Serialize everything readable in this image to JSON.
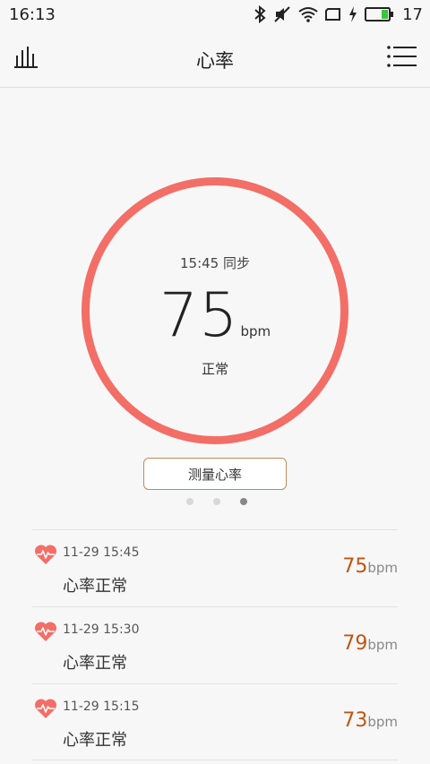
{
  "status_bar": {
    "time": "16:13",
    "battery_level": "17",
    "icons": [
      "bluetooth-icon",
      "mute-icon",
      "wifi-icon",
      "screen-rotate-icon",
      "charging-icon",
      "battery-icon"
    ]
  },
  "header": {
    "title": "心率",
    "left_icon": "bar-chart-icon",
    "right_icon": "list-menu-icon"
  },
  "current": {
    "sync_text": "15:45 同步",
    "value": "75",
    "unit": "bpm",
    "status": "正常",
    "ring_color": "#f36e66"
  },
  "measure_button": {
    "label": "测量心率"
  },
  "pager": {
    "count": 3,
    "active_index": 2
  },
  "records": [
    {
      "time": "11-29 15:45",
      "status": "心率正常",
      "value": "75",
      "unit": "bpm"
    },
    {
      "time": "11-29 15:30",
      "status": "心率正常",
      "value": "79",
      "unit": "bpm"
    },
    {
      "time": "11-29 15:15",
      "status": "心率正常",
      "value": "73",
      "unit": "bpm"
    }
  ],
  "colors": {
    "accent": "#f36e66",
    "value_color": "#c0560e",
    "button_border": "#c08a55"
  }
}
